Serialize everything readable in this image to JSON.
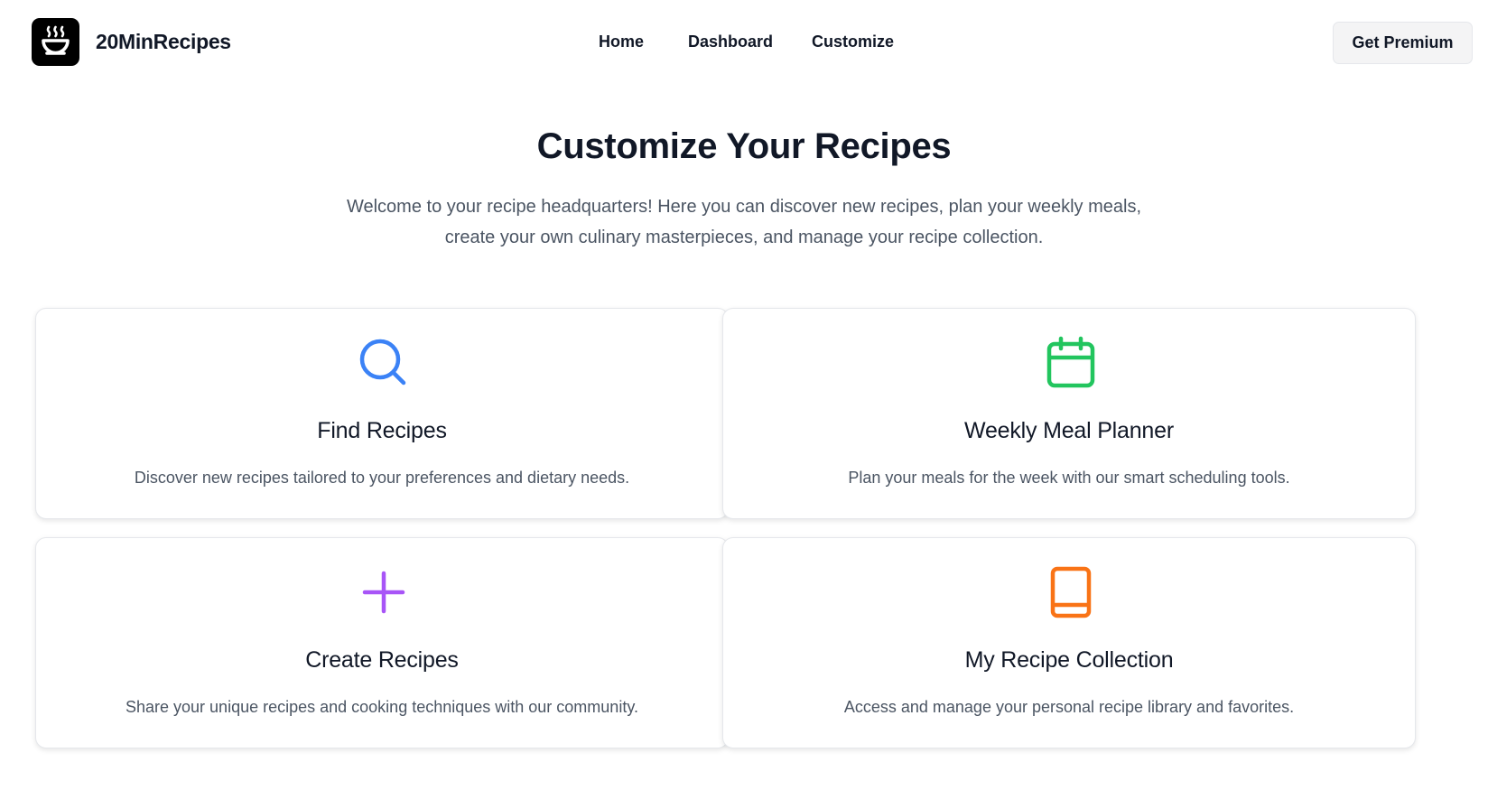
{
  "header": {
    "brand": "20MinRecipes",
    "nav": [
      {
        "label": "Home"
      },
      {
        "label": "Dashboard"
      },
      {
        "label": "Customize"
      }
    ],
    "premium_label": "Get Premium",
    "logo_icon": "steaming-bowl-icon"
  },
  "main": {
    "title": "Customize Your Recipes",
    "intro_line1": "Welcome to your recipe headquarters! Here you can discover new recipes, plan your weekly meals,",
    "intro_line2": "create your own culinary masterpieces, and manage your recipe collection."
  },
  "cards": [
    {
      "title": "Find Recipes",
      "description": "Discover new recipes tailored to your preferences and dietary needs.",
      "icon": "search-icon",
      "color": "#3b82f6"
    },
    {
      "title": "Weekly Meal Planner",
      "description": "Plan your meals for the week with our smart scheduling tools.",
      "icon": "calendar-icon",
      "color": "#22c55e"
    },
    {
      "title": "Create Recipes",
      "description": "Share your unique recipes and cooking techniques with our community.",
      "icon": "plus-icon",
      "color": "#a855f7"
    },
    {
      "title": "My Recipe Collection",
      "description": "Access and manage your personal recipe library and favorites.",
      "icon": "book-icon",
      "color": "#f97316"
    }
  ]
}
